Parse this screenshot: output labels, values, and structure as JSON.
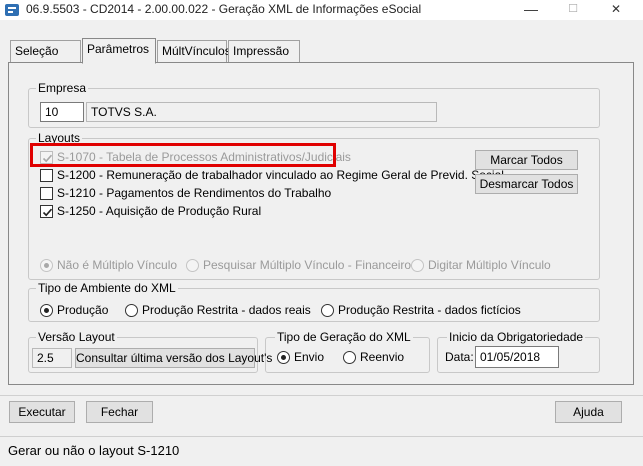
{
  "window": {
    "title": "06.9.5503 - CD2014 - 2.00.00.022 - Geração XML de Informações eSocial",
    "minimize_glyph": "—",
    "maximize_glyph": "☐",
    "close_glyph": "✕"
  },
  "tabs": [
    {
      "label": "Seleção"
    },
    {
      "label": "Parâmetros"
    },
    {
      "label": "MúltVínculos"
    },
    {
      "label": "Impressão"
    }
  ],
  "empresa": {
    "legend": "Empresa",
    "code": "10",
    "name": "TOTVS S.A."
  },
  "layouts": {
    "legend": "Layouts",
    "items": [
      {
        "label": "S-1070 - Tabela de Processos Administrativos/Judiciais",
        "checked": true,
        "enabled": false
      },
      {
        "label": "S-1200 - Remuneração de trabalhador vinculado ao Regime Geral de Previd. Social",
        "checked": false,
        "enabled": true
      },
      {
        "label": "S-1210 - Pagamentos de Rendimentos do Trabalho",
        "checked": false,
        "enabled": true
      },
      {
        "label": "S-1250 - Aquisição de Produção Rural",
        "checked": true,
        "enabled": true
      }
    ],
    "marcar_todos": "Marcar Todos",
    "desmarcar_todos": "Desmarcar Todos",
    "vinculo_options": [
      {
        "label": "Não é Múltiplo Vínculo",
        "selected": true
      },
      {
        "label": "Pesquisar Múltiplo Vínculo - Financeiro",
        "selected": false
      },
      {
        "label": "Digitar Múltiplo Vínculo",
        "selected": false
      }
    ]
  },
  "ambiente": {
    "legend": "Tipo de Ambiente do XML",
    "options": [
      {
        "label": "Produção",
        "selected": true
      },
      {
        "label": "Produção Restrita - dados reais",
        "selected": false
      },
      {
        "label": "Produção Restrita - dados fictícios",
        "selected": false
      }
    ]
  },
  "versao": {
    "legend": "Versão Layout",
    "value": "2.5",
    "button": "Consultar última versão dos Layout's"
  },
  "geracao": {
    "legend": "Tipo de Geração do XML",
    "options": [
      {
        "label": "Envio",
        "selected": true
      },
      {
        "label": "Reenvio",
        "selected": false
      }
    ]
  },
  "obrigatoriedade": {
    "legend": "Inicio da Obrigatoriedade",
    "data_label": "Data:",
    "data_value": "01/05/2018"
  },
  "footer": {
    "executar": "Executar",
    "fechar": "Fechar",
    "ajuda": "Ajuda"
  },
  "status": "Gerar ou não o layout S-1210",
  "colors": {
    "highlight": "#e00000",
    "background": "#f0f0f0"
  }
}
